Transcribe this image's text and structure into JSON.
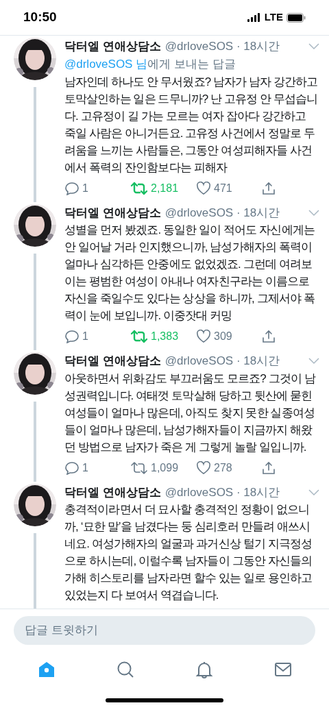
{
  "status_bar": {
    "time": "10:50",
    "network": "LTE"
  },
  "tweets": [
    {
      "name": "닥터엘 연애상담소",
      "handle": "@drloveSOS",
      "time": "· 18시간",
      "reply_to": {
        "link": "@drloveSOS 님",
        "rest": "에게 보내는 답글"
      },
      "text": "남자인데 하나도 안 무서웠죠? 남자가 남자 강간하고 토막살인하는 일은 드무니까? 난 고유정 안 무섭습니다. 고유정이 길 가는 모르는 여자 잡아다 강간하고 죽일 사람은 아니거든요. 고유정 사건에서 정말로 두려움을 느끼는 사람들은, 그동안 여성피해자들 사건에서 폭력의 잔인함보다는 피해자",
      "actions": {
        "replies": "1",
        "retweets": "2,181",
        "retweeted": true,
        "likes": "471"
      }
    },
    {
      "name": "닥터엘 연애상담소",
      "handle": "@drloveSOS",
      "time": "· 18시간",
      "text": "성별을 먼저 봤겠죠. 동일한 일이 적어도 자신에게는 안 일어날 거라 인지했으니까, 남성가해자의 폭력이 얼마나 심각하든 안중에도 없었겠죠. 그런데 여려보이는 평범한 여성이 아내나 여자친구라는 이름으로 자신을 죽일수도 있다는 상상을 하니까, 그제서야 폭력이 눈에 보입니까. 이중잣대 커밍",
      "actions": {
        "replies": "1",
        "retweets": "1,383",
        "retweeted": true,
        "likes": "309"
      }
    },
    {
      "name": "닥터엘 연애상담소",
      "handle": "@drloveSOS",
      "time": "· 18시간",
      "text": "아웃하면서 위화감도 부끄러움도 모르죠? 그것이 남성권력입니다. 여태껏 토막살해 당하고 뒷산에 묻힌 여성들이 얼마나 많은데, 아직도 찾지 못한 실종여성들이 얼마나 많은데, 남성가해자들이 지금까지 해왔던 방법으로 남자가 죽은 게 그렇게 놀랄 일입니까.",
      "actions": {
        "replies": "1",
        "retweets": "1,099",
        "retweeted": false,
        "likes": "278"
      }
    },
    {
      "name": "닥터엘 연애상담소",
      "handle": "@drloveSOS",
      "time": "· 18시간",
      "text": "충격적이라면서 더 묘사할 충격적인 정황이 없으니까, ‘묘한 말’을 남겼다는 둥 심리호러 만들려 애쓰시네요. 여성가해자의 얼굴과 과거신상 털기 지극정성으로 하시는데, 이럴수록 남자들이 그동안 자신들의 가해 히스토리를 남자라면 할수 있는 일로 용인하고 있었는지 다 보여서 역겹습니다."
    }
  ],
  "reply_field": {
    "placeholder": "답글 트윗하기"
  },
  "tab_bar": [
    {
      "selected": true
    },
    {
      "selected": false
    },
    {
      "selected": false
    },
    {
      "selected": false
    }
  ]
}
